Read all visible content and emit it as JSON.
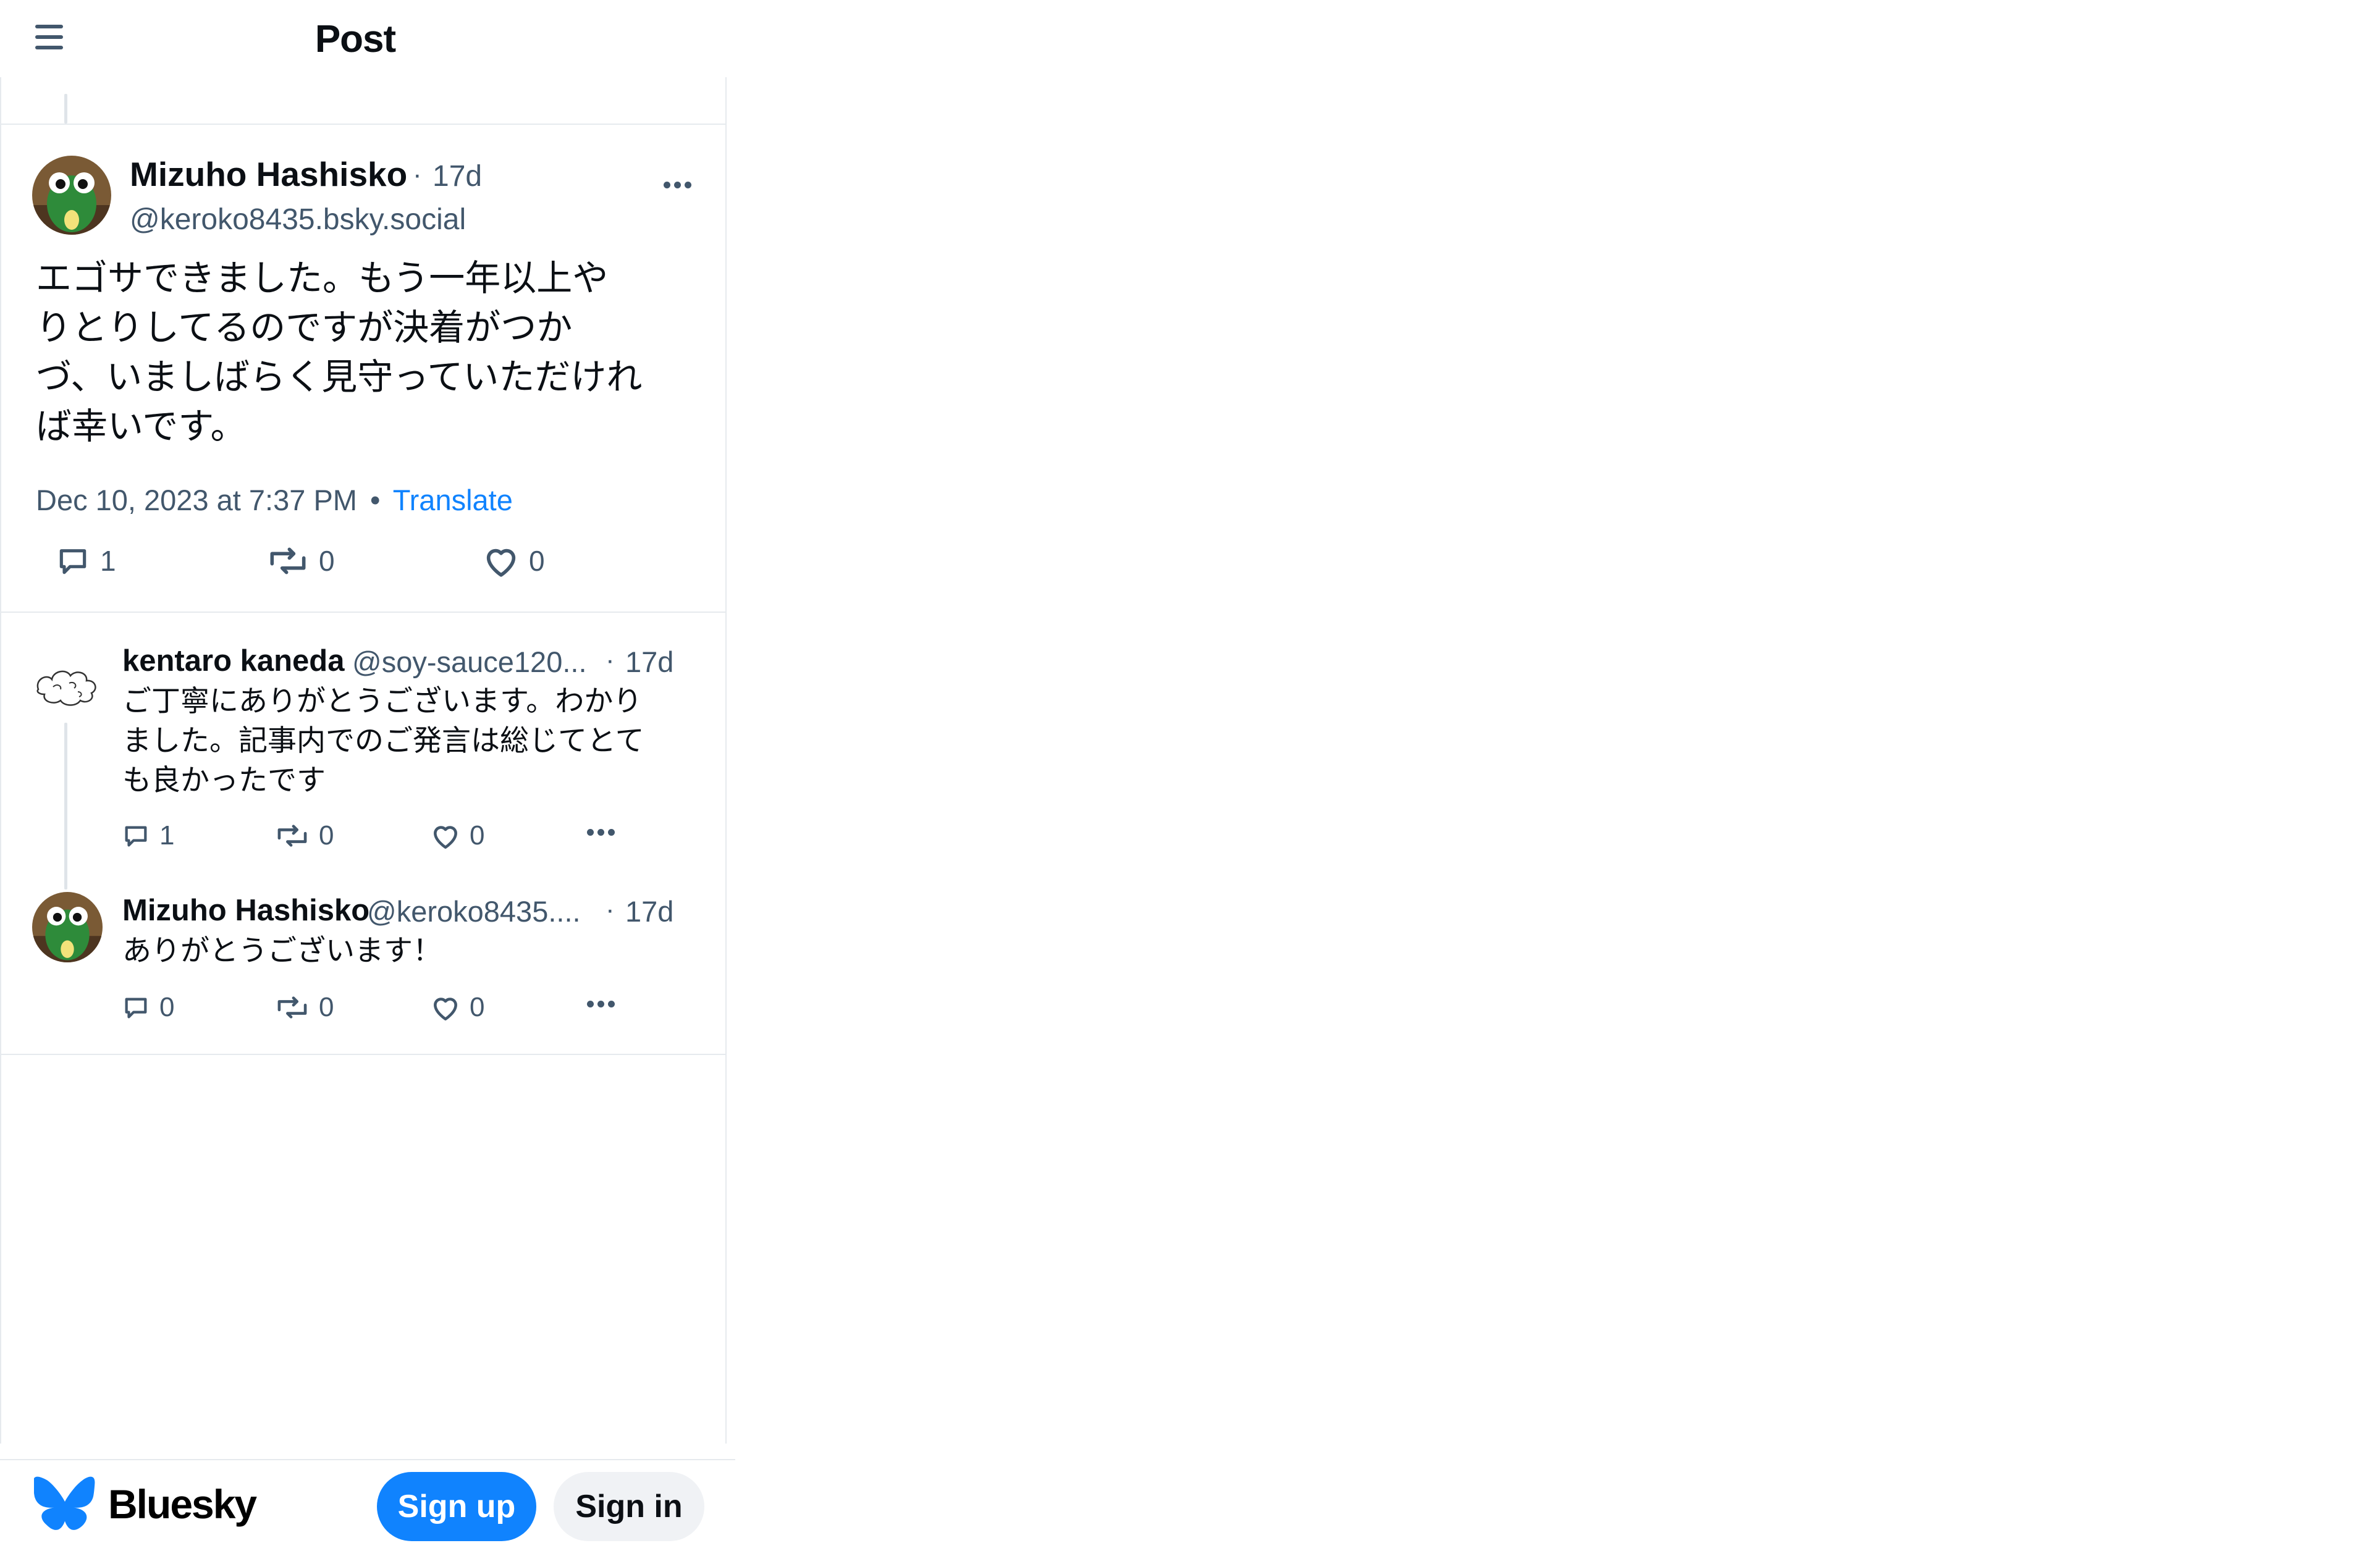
{
  "header": {
    "title": "Post",
    "menu_icon": "hamburger-icon"
  },
  "main_post": {
    "author_name": "Mizuho Hashisko",
    "dot": "·",
    "time_ago": "17d",
    "handle": "@keroko8435.bsky.social",
    "text": "エゴサできました。もう一年以上や\nりとりしてるのですが決着がつか\nづ、いましばらく見守っていただけれ\nば幸いです。",
    "timestamp": "Dec 10, 2023 at 7:37 PM",
    "bullet": "•",
    "translate_label": "Translate",
    "replies": "1",
    "reposts": "0",
    "likes": "0"
  },
  "replies": [
    {
      "author_name": "kentaro kaneda",
      "handle": "@soy-sauce120...",
      "dot": "·",
      "time_ago": "17d",
      "text": "ご丁寧にありがとうございます。わかり\nました。記事内でのご発言は総じてとて\nも良かったです",
      "replies": "1",
      "reposts": "0",
      "likes": "0"
    },
    {
      "author_name": "Mizuho Hashisko",
      "handle": "@keroko8435....",
      "dot": "·",
      "time_ago": "17d",
      "text": "ありがとうございます！",
      "replies": "0",
      "reposts": "0",
      "likes": "0"
    }
  ],
  "footer": {
    "brand": "Bluesky",
    "signup_label": "Sign up",
    "signin_label": "Sign in"
  },
  "colors": {
    "accent": "#1083fe",
    "muted": "#42576c",
    "border": "#e6eaee"
  }
}
